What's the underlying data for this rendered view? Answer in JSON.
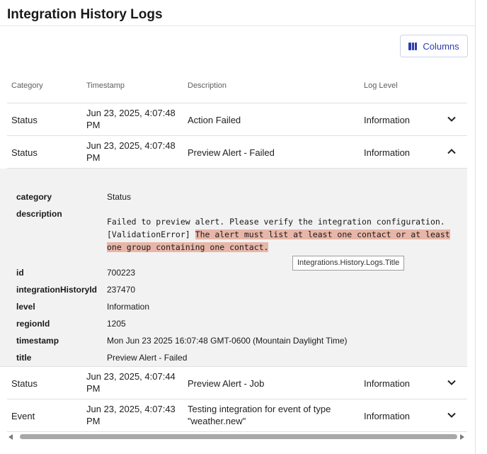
{
  "page": {
    "title": "Integration History Logs"
  },
  "toolbar": {
    "columns_label": "Columns",
    "columns_icon": "columns-icon"
  },
  "table": {
    "headers": [
      "Category",
      "Timestamp",
      "Description",
      "Log Level"
    ],
    "rows": [
      {
        "category": "Status",
        "timestamp": "Jun 23, 2025, 4:07:48 PM",
        "description": "Action Failed",
        "level": "Information",
        "expanded": false
      },
      {
        "category": "Status",
        "timestamp": "Jun 23, 2025, 4:07:48 PM",
        "description": "Preview Alert - Failed",
        "level": "Information",
        "expanded": true
      },
      {
        "category": "Status",
        "timestamp": "Jun 23, 2025, 4:07:44 PM",
        "description": "Preview Alert - Job",
        "level": "Information",
        "expanded": false
      },
      {
        "category": "Event",
        "timestamp": "Jun 23, 2025, 4:07:43 PM",
        "description": "Testing integration for event of type \"weather.new\"",
        "level": "Information",
        "expanded": false
      }
    ]
  },
  "detail": {
    "category": {
      "key": "category",
      "value": "Status"
    },
    "description": {
      "key": "description",
      "line1": "Failed to preview alert. Please verify the integration configuration.",
      "line2_prefix": "[ValidationError]",
      "highlight_a": "The alert must list at least one contact or at least",
      "highlight_b": "one group containing one contact."
    },
    "id": {
      "key": "id",
      "value": "700223"
    },
    "integrationHistoryId": {
      "key": "integrationHistoryId",
      "value": "237470"
    },
    "level": {
      "key": "level",
      "value": "Information"
    },
    "regionId": {
      "key": "regionId",
      "value": "1205"
    },
    "timestamp": {
      "key": "timestamp",
      "value": "Mon Jun 23 2025 16:07:48 GMT-0600 (Mountain Daylight Time)"
    },
    "title": {
      "key": "title",
      "value": "Preview Alert - Failed"
    }
  },
  "tooltip": {
    "text": "Integrations.History.Logs.Title"
  },
  "colors": {
    "accent": "#2f3ea8",
    "highlight": "#e8b6a8",
    "detail_bg": "#f2f2f2"
  }
}
